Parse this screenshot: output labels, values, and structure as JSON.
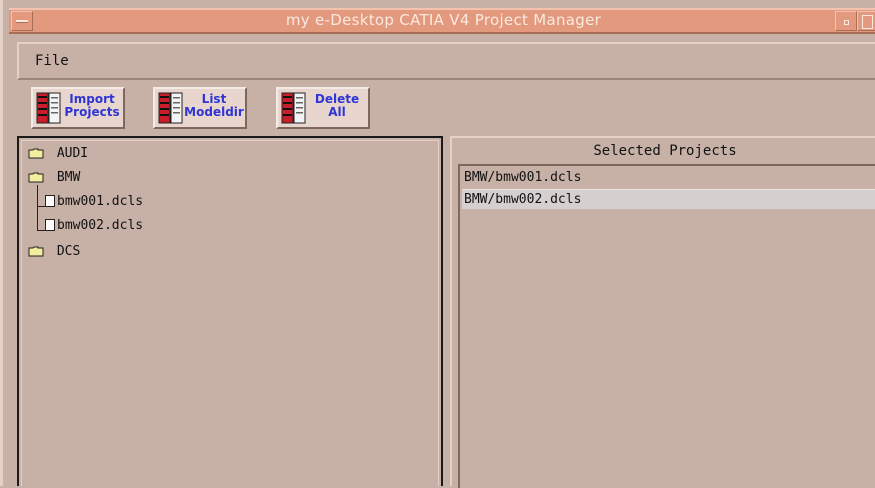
{
  "window": {
    "title": "my e-Desktop CATIA V4 Project Manager"
  },
  "menu": {
    "file_label": "File"
  },
  "toolbar": {
    "import": {
      "line1": "Import",
      "line2": "Projects"
    },
    "list": {
      "line1": "List",
      "line2": "Modeldir"
    },
    "delete": {
      "line1": "Delete",
      "line2": "All"
    }
  },
  "tree": {
    "items": [
      {
        "label": "AUDI",
        "type": "folder"
      },
      {
        "label": "BMW",
        "type": "folder"
      },
      {
        "label": "bmw001.dcls",
        "type": "file"
      },
      {
        "label": "bmw002.dcls",
        "type": "file"
      },
      {
        "label": "DCS",
        "type": "folder"
      }
    ]
  },
  "selected": {
    "header": "Selected Projects",
    "items": [
      "BMW/bmw001.dcls",
      "BMW/bmw002.dcls"
    ]
  },
  "colors": {
    "background": "#c7b1a6",
    "titlebar": "#e3997d",
    "button_text": "#2f35d4",
    "folder": "#f2ee9e"
  },
  "icons": {
    "titlebar_menu": "window-menu-icon",
    "toolbar": "book-stack-icon",
    "tree_folder": "folder-icon",
    "tree_file": "file-icon"
  }
}
